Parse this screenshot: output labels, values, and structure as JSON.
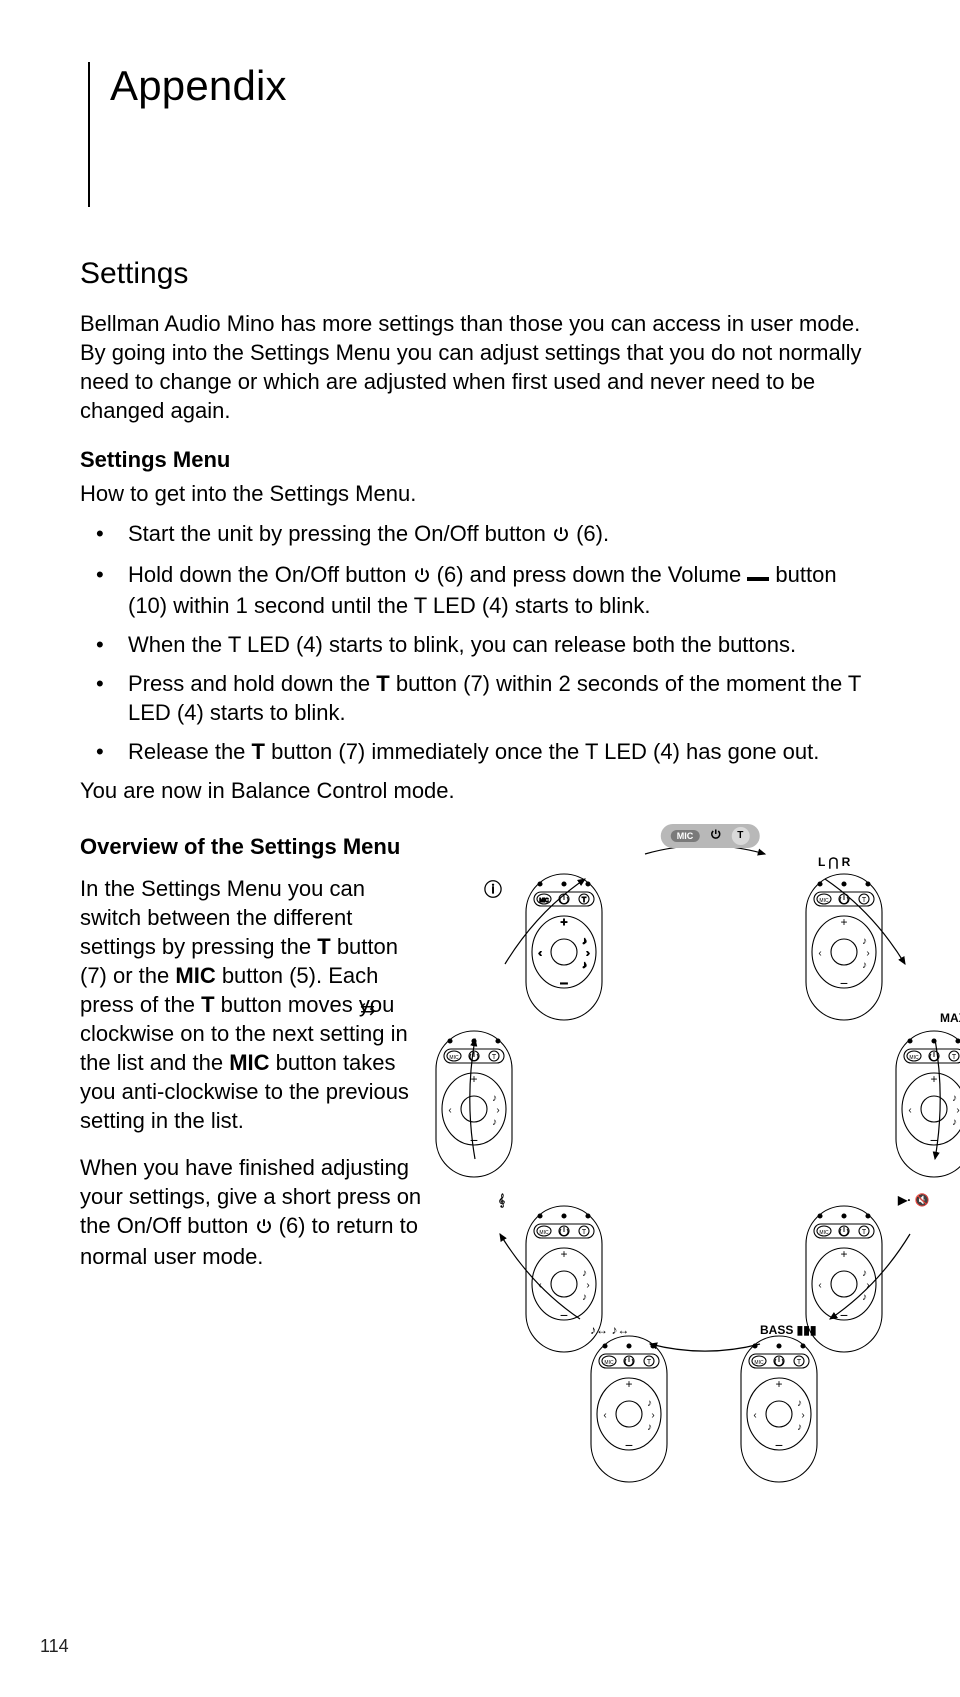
{
  "title": "Appendix",
  "section": "Settings",
  "intro": "Bellman Audio Mino has more settings than those you can access in user mode. By going into the Settings Menu you can adjust settings that you do not normally need to change or which are adjusted when first used and never need to be changed again.",
  "settings_menu_h": "Settings Menu",
  "settings_menu_sub": "How to get into the Settings Menu.",
  "bullets": {
    "b1a": "Start the unit by pressing the On/Off button ",
    "b1b": " (6).",
    "b2a": "Hold down the On/Off button ",
    "b2b": " (6) and press down the Volume ",
    "b2c": " button (10) within 1 second until the T LED (4) starts to blink.",
    "b3": "When the T LED (4) starts to blink, you can release both the buttons.",
    "b4a": "Press and hold down the ",
    "b4b": "T",
    "b4c": " button (7) within 2 seconds of the moment the T LED (4) starts to blink.",
    "b5a": "Release the ",
    "b5b": "T",
    "b5c": " button (7) immediately once the T LED (4) has gone out."
  },
  "balance_line": "You are now in Balance Control mode.",
  "overview_h": "Overview of the Settings Menu",
  "overview_p1a": "In the Settings Menu you can switch between the different settings by pressing the ",
  "overview_p1b": "T",
  "overview_p1c": " button (7) or the ",
  "overview_p1d": "MIC",
  "overview_p1e": " button (5). Each press of the ",
  "overview_p1f": "T",
  "overview_p1g": " button moves you clockwise on to the next setting in the list and the ",
  "overview_p1h": "MIC",
  "overview_p1i": " button takes you anti-clockwise to the previous setting in the list.",
  "overview_p2a": "When you have finished adjusting your settings, give a short press on the On/Off button ",
  "overview_p2b": " (6) to return to normal user mode.",
  "pill": {
    "mic": "MIC",
    "t": "T"
  },
  "labels": {
    "info": "ⓘ",
    "swap": "⇆",
    "headphones_lr": "L ⋂ R",
    "max": "MAX 🔊",
    "mute": "▶· 🔇",
    "bass": "BASS ▮▮▮",
    "tone_arrows": "♪↔ ♪↔",
    "ear": "𝄞"
  },
  "page_number": "114"
}
